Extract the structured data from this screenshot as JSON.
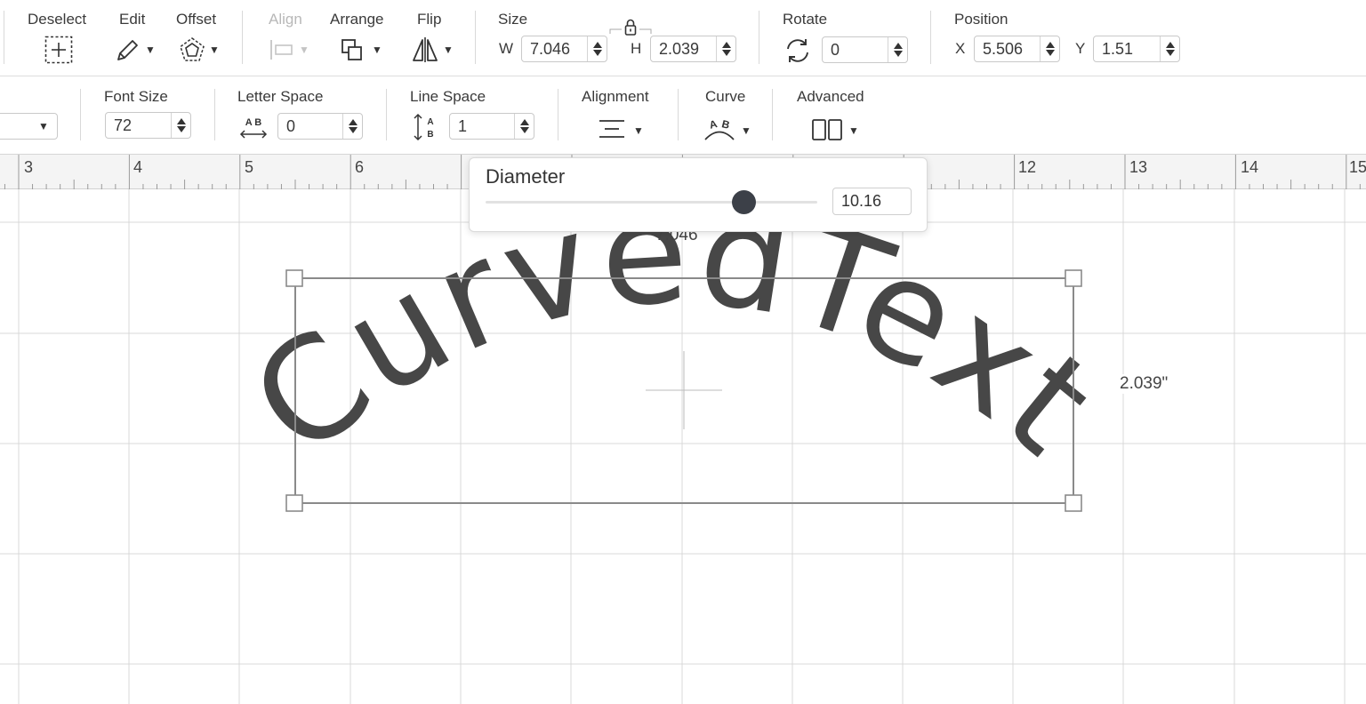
{
  "toolbar_top": {
    "deselect_label": "Deselect",
    "edit_label": "Edit",
    "offset_label": "Offset",
    "align_label": "Align",
    "arrange_label": "Arrange",
    "flip_label": "Flip",
    "size": {
      "label": "Size",
      "w_label": "W",
      "w_value": "7.046",
      "h_label": "H",
      "h_value": "2.039"
    },
    "rotate": {
      "label": "Rotate",
      "value": "0"
    },
    "position": {
      "label": "Position",
      "x_label": "X",
      "x_value": "5.506",
      "y_label": "Y",
      "y_value": "1.51"
    }
  },
  "toolbar_text": {
    "font_size": {
      "label": "Font Size",
      "value": "72"
    },
    "letter_space": {
      "label": "Letter Space",
      "value": "0"
    },
    "line_space": {
      "label": "Line Space",
      "value": "1"
    },
    "alignment_label": "Alignment",
    "curve_label": "Curve",
    "advanced_label": "Advanced"
  },
  "ruler": {
    "ticks": [
      "3",
      "4",
      "5",
      "6",
      "12",
      "13",
      "14",
      "15"
    ]
  },
  "diameter_popover": {
    "title": "Diameter",
    "value": "10.16",
    "slider_fraction": 0.78
  },
  "canvas": {
    "curved_text": "CurvedText",
    "width_dimension": "7.046\"",
    "height_dimension": "2.039\""
  },
  "colors": {
    "text_fill": "#474747",
    "ui_text": "#3a3a3a",
    "grid_line": "#d9d9d9",
    "slider_thumb": "#3c4048",
    "disabled": "#b8b8b8"
  },
  "icons": [
    "deselect-icon",
    "edit-pencil-icon",
    "offset-icon",
    "align-icon",
    "arrange-icon",
    "flip-icon",
    "lock-icon",
    "rotate-icon",
    "letter-space-icon",
    "line-space-icon",
    "alignment-icon",
    "curve-icon",
    "advanced-icon"
  ]
}
